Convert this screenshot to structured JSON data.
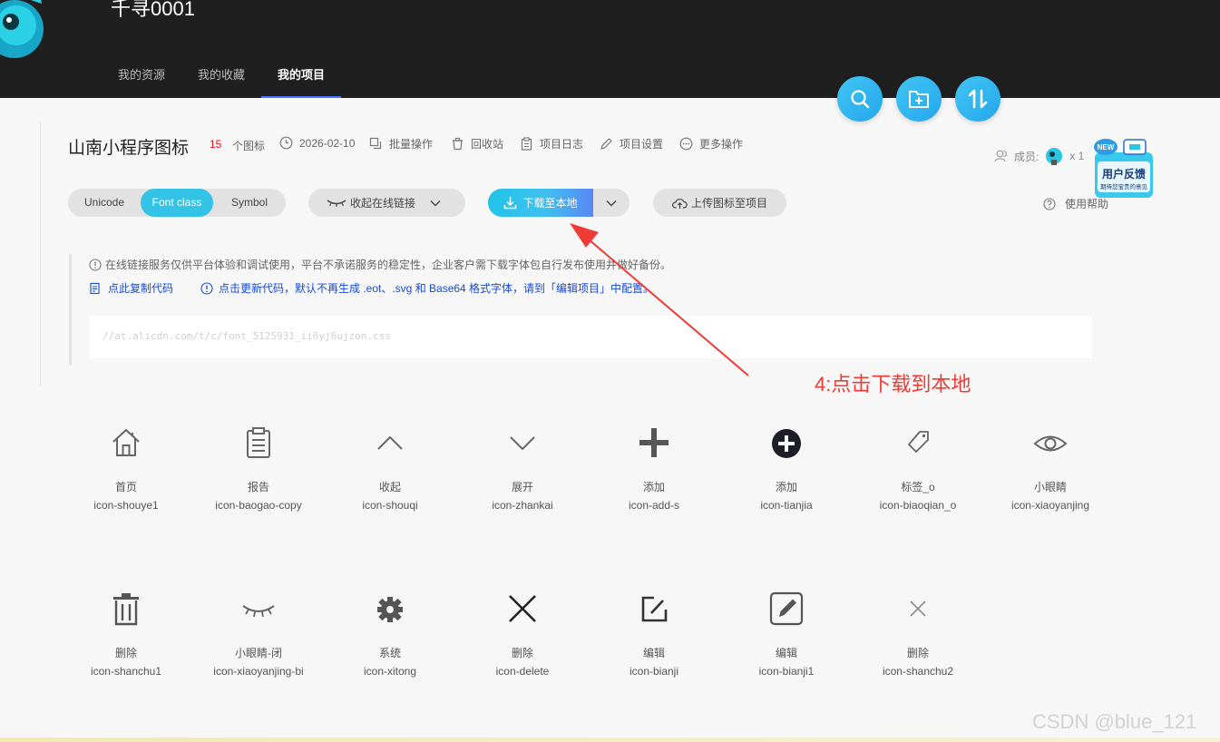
{
  "header": {
    "username": "千寻0001",
    "nav": [
      "我的资源",
      "我的收藏",
      "我的项目"
    ],
    "active_nav": "我的项目"
  },
  "project": {
    "title": "山南小程序图标",
    "count": "15",
    "count_label": "个图标",
    "date": "2026-02-10",
    "actions": [
      "批量操作",
      "回收站",
      "项目日志",
      "项目设置",
      "更多操作"
    ],
    "members_label": "成员:",
    "members_count": "x 1",
    "feedback": {
      "badge": "NEW",
      "title": "用户反馈",
      "subtitle": "期待您宝贵的意见"
    },
    "help": "使用帮助"
  },
  "toolbar": {
    "tabs": [
      "Unicode",
      "Font class",
      "Symbol"
    ],
    "active_tab": "Font class",
    "collapse_link": "收起在线链接",
    "download": "下载至本地",
    "upload": "上传图标至项目"
  },
  "notice": {
    "warning": "在线链接服务仅供平台体验和调试使用，平台不承诺服务的稳定性，企业客户需下载字体包自行发布使用并做好备份。",
    "copy_code": "点此复制代码",
    "update_code": "点击更新代码，默认不再生成 .eot、.svg 和 Base64 格式字体，请到「编辑项目」中配置。",
    "link": "//at.alicdn.com/t/c/font_5125931_ii6yj6ujzon.css"
  },
  "annotation": "4:点击下载到本地",
  "icons": [
    {
      "name": "首页",
      "code": "icon-shouye1",
      "glyph": "home-icon"
    },
    {
      "name": "报告",
      "code": "icon-baogao-copy",
      "glyph": "report-icon"
    },
    {
      "name": "收起",
      "code": "icon-shouqi",
      "glyph": "chevron-up-icon"
    },
    {
      "name": "展开",
      "code": "icon-zhankai",
      "glyph": "chevron-down-icon"
    },
    {
      "name": "添加",
      "code": "icon-add-s",
      "glyph": "plus-icon"
    },
    {
      "name": "添加",
      "code": "icon-tianjia",
      "glyph": "plus-circle-icon"
    },
    {
      "name": "标签_o",
      "code": "icon-biaoqian_o",
      "glyph": "tag-icon"
    },
    {
      "name": "小眼睛",
      "code": "icon-xiaoyanjing",
      "glyph": "eye-icon"
    },
    {
      "name": "删除",
      "code": "icon-shanchu1",
      "glyph": "trash-icon"
    },
    {
      "name": "小眼睛-闭",
      "code": "icon-xiaoyanjing-bi",
      "glyph": "eye-closed-icon"
    },
    {
      "name": "系统",
      "code": "icon-xitong",
      "glyph": "gear-icon"
    },
    {
      "name": "删除",
      "code": "icon-delete",
      "glyph": "close-icon"
    },
    {
      "name": "编辑",
      "code": "icon-bianji",
      "glyph": "edit-icon"
    },
    {
      "name": "编辑",
      "code": "icon-bianji1",
      "glyph": "edit-square-icon"
    },
    {
      "name": "删除",
      "code": "icon-shanchu2",
      "glyph": "close-thin-icon"
    }
  ],
  "watermark": "CSDN @blue_121",
  "colors": {
    "accent": "#33c3e6",
    "header_bg": "#1f1f1f",
    "annotation": "#ef3b35",
    "link": "#1a4bd6"
  }
}
